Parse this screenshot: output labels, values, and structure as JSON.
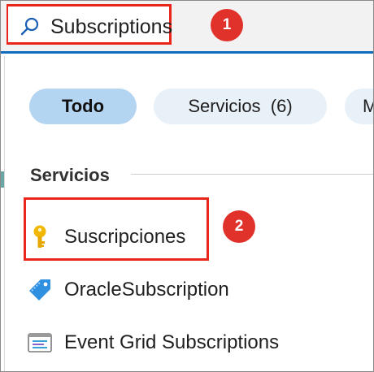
{
  "search": {
    "value": "Subscriptions",
    "icon": "search-icon"
  },
  "callouts": [
    "1",
    "2"
  ],
  "filters": [
    {
      "label": "Todo",
      "active": true
    },
    {
      "label": "Servicios  (6)",
      "active": false
    },
    {
      "label": "M",
      "active": false
    }
  ],
  "section": {
    "title": "Servicios"
  },
  "results": [
    {
      "label": "Suscripciones",
      "icon": "key-icon"
    },
    {
      "label": "OracleSubscription",
      "icon": "oracle-tag-icon"
    },
    {
      "label": "Event Grid Subscriptions",
      "icon": "event-grid-icon"
    }
  ],
  "colors": {
    "accent": "#0f6cbd",
    "callout": "#e0312a",
    "highlight": "#e8261c",
    "active_pill": "#b4d5f2",
    "inactive_pill": "#e8f0f8"
  }
}
